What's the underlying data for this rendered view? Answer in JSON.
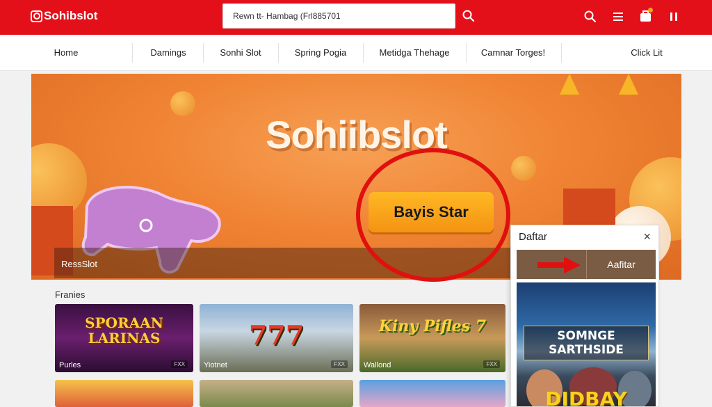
{
  "header": {
    "logo": "Sohibslot",
    "search_value": "Rewn tt- Hambag (Frl885701",
    "icons": [
      "search-icon",
      "menu-icon",
      "notification-icon",
      "pause-icon"
    ],
    "colors": {
      "brand": "#e3101a",
      "accent": "#f49313"
    }
  },
  "nav": {
    "items": [
      {
        "label": "Home"
      },
      {
        "label": "Damings"
      },
      {
        "label": "Sonhi Slot"
      },
      {
        "label": "Spring Pogia"
      },
      {
        "label": "Metidga Thehage"
      },
      {
        "label": "Camnar Torges!"
      },
      {
        "label": "Click Lit"
      }
    ]
  },
  "banner": {
    "title": "Sohiibslot",
    "cta_label": "Bayis Star",
    "caption": "RessSlot"
  },
  "games": {
    "section_title": "Franies",
    "tiles": [
      {
        "label": "Purles",
        "art": "SPORAAN LARINAS",
        "tag": "FXX"
      },
      {
        "label": "Yiotnet",
        "art": "777",
        "tag": "FXX"
      },
      {
        "label": "Wallond",
        "art": "Kiny Pifles 7",
        "tag": "FXX"
      }
    ]
  },
  "popup": {
    "title": "Daftar",
    "close": "×",
    "tab_right": "Aafitar",
    "promo_title": "SOMNGE SARTHSIDE",
    "promo_bottom": "DIDBAY"
  }
}
